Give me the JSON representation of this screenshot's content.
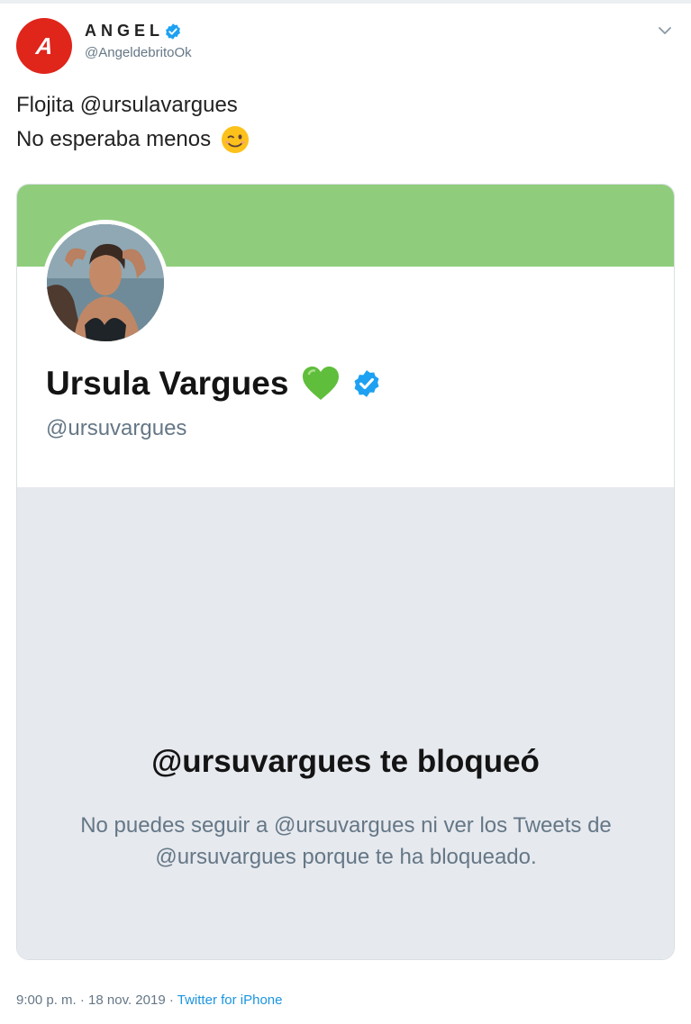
{
  "tweet": {
    "author": {
      "avatar_letter": "A",
      "name": "ANGEL",
      "handle": "@AngeldebritoOk",
      "verified": true
    },
    "text_lines": [
      "Flojita @ursulavargues",
      "No esperaba menos"
    ],
    "text_emoji": "wink-emoji",
    "meta": {
      "time": "9:00 p. m.",
      "separator": "·",
      "date": "18 nov. 2019",
      "source": "Twitter for iPhone"
    }
  },
  "profile_card": {
    "name": "Ursula Vargues",
    "name_emoji": "green-heart-emoji",
    "verified": true,
    "handle": "@ursuvargues",
    "banner_color": "#8fcd7c",
    "blocked": {
      "title": "@ursuvargues te bloqueó",
      "message": "No puedes seguir a @ursuvargues ni ver los Tweets de @ursuvargues porque te ha bloqueado."
    }
  },
  "colors": {
    "brand_red": "#e0251b",
    "verified_blue": "#1da1f2",
    "link_blue": "#1b95e0",
    "muted_gray": "#657786",
    "panel_gray": "#e6e9ee"
  }
}
